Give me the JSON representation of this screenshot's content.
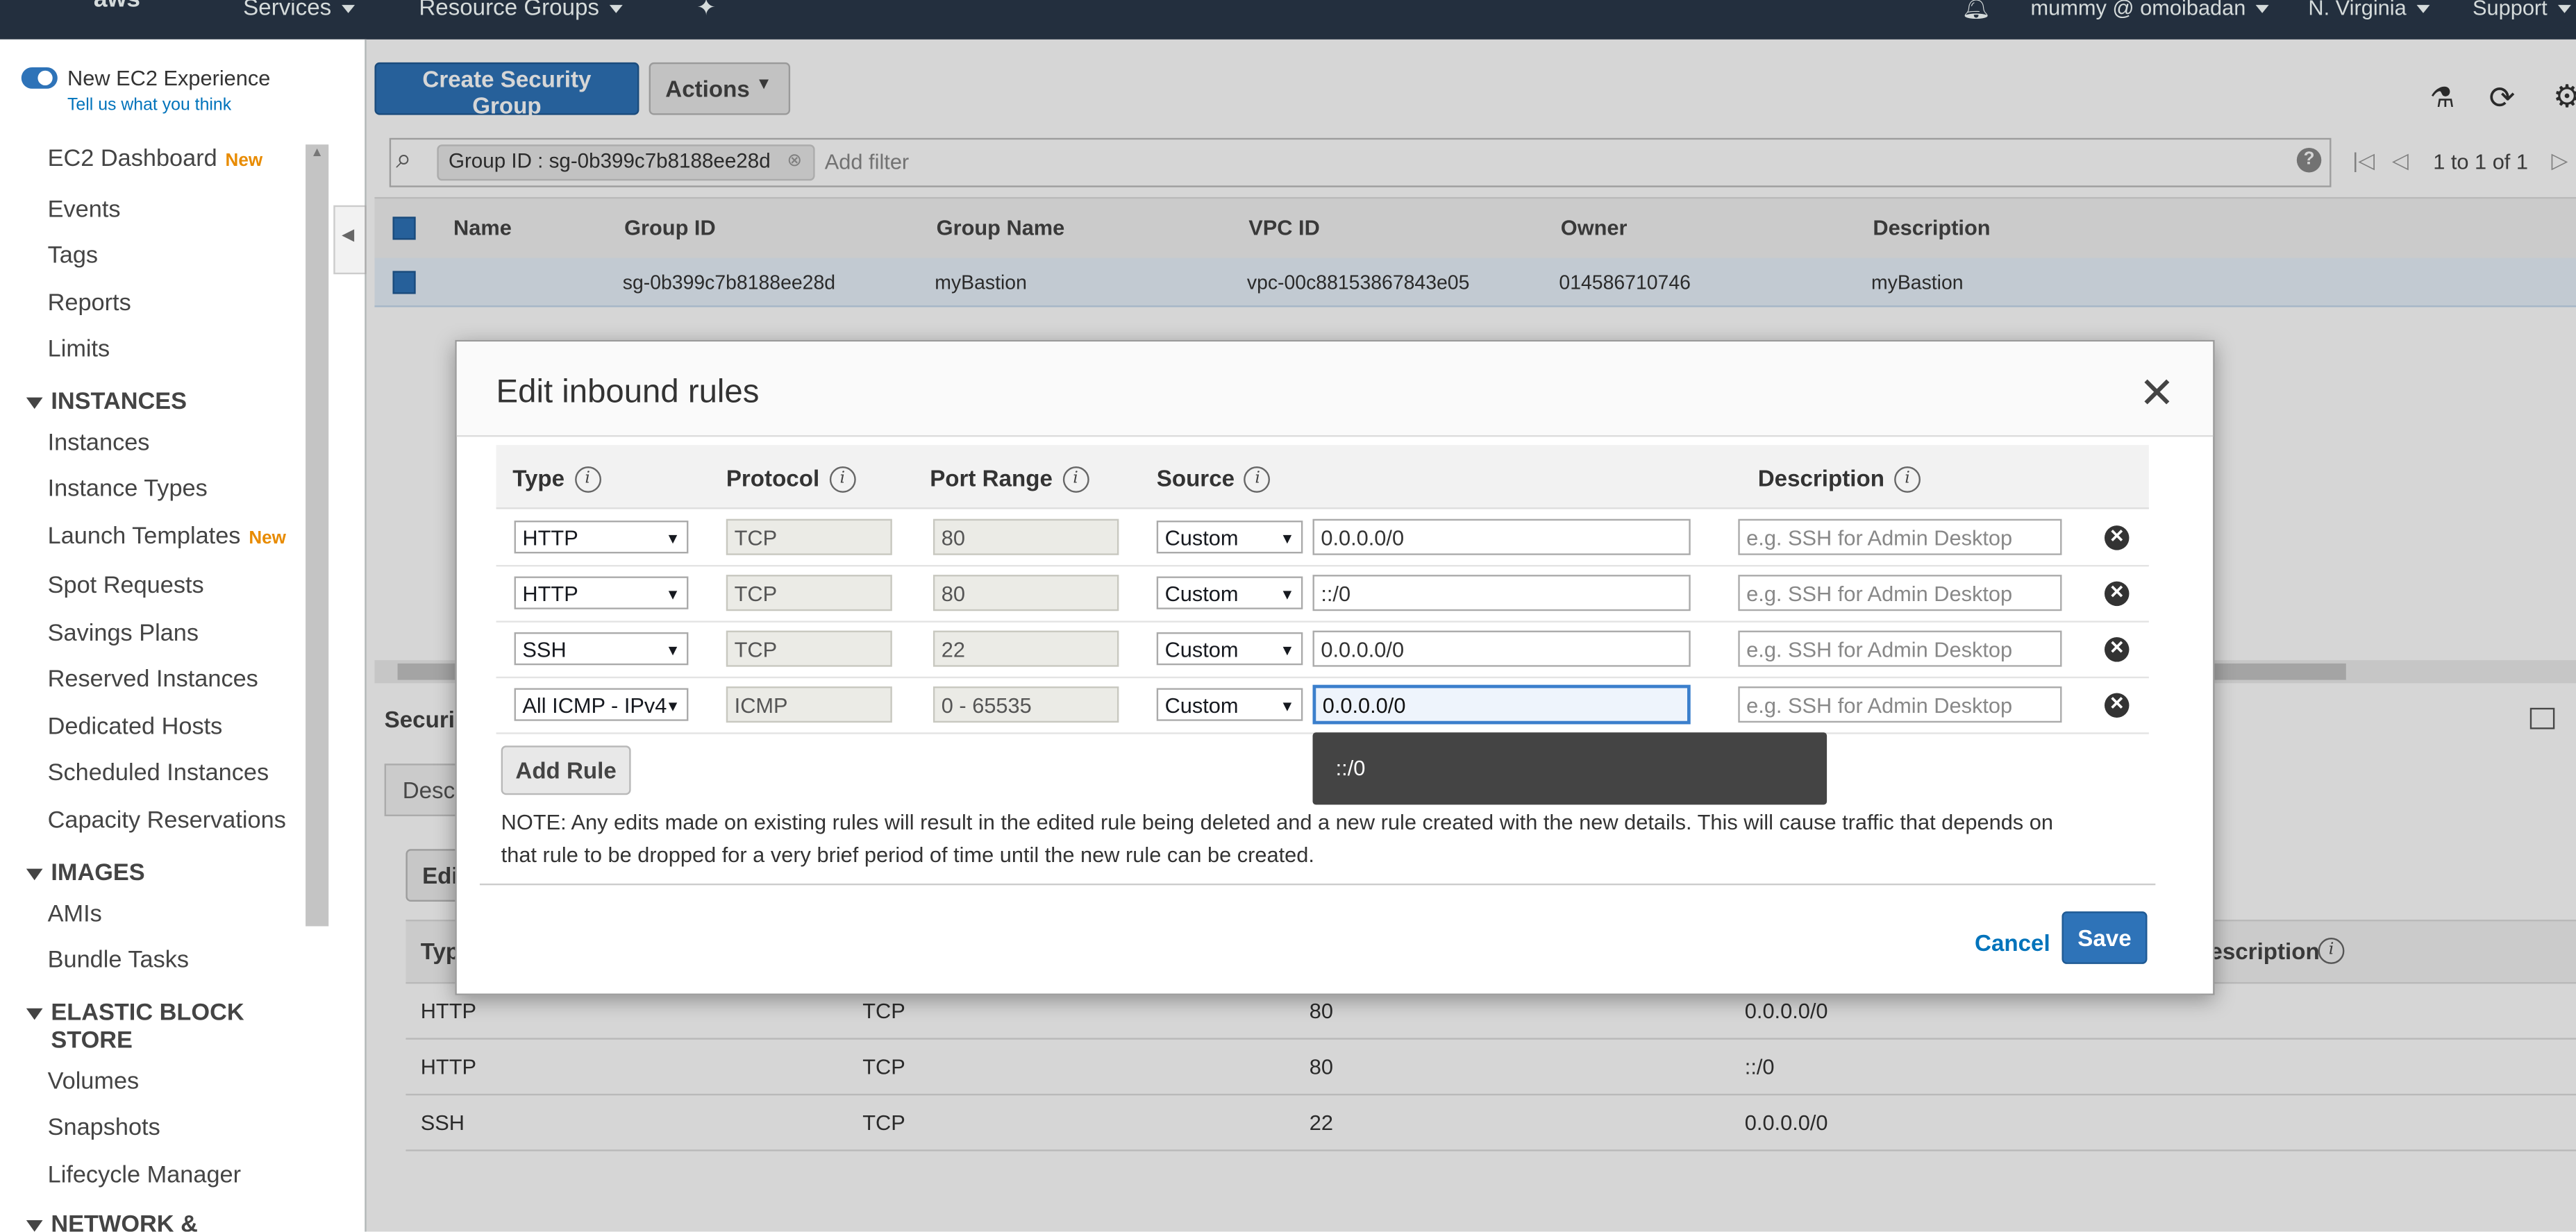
{
  "nav": {
    "logo": "aws",
    "services": "Services",
    "resource_groups": "Resource Groups",
    "account": "mummy @ omoibadan",
    "region": "N. Virginia",
    "support": "Support"
  },
  "sidebar": {
    "toggle_label": "New EC2 Experience",
    "toggle_link": "Tell us what you think",
    "dashboard": "EC2 Dashboard",
    "new_badge": "New",
    "items_top": [
      "Events",
      "Tags",
      "Reports",
      "Limits"
    ],
    "instances_header": "INSTANCES",
    "instances": [
      "Instances",
      "Instance Types",
      "Launch Templates",
      "Spot Requests",
      "Savings Plans",
      "Reserved Instances",
      "Dedicated Hosts",
      "Scheduled Instances",
      "Capacity Reservations"
    ],
    "images_header": "IMAGES",
    "images": [
      "AMIs",
      "Bundle Tasks"
    ],
    "ebs_header_1": "ELASTIC BLOCK",
    "ebs_header_2": "STORE",
    "ebs": [
      "Volumes",
      "Snapshots",
      "Lifecycle Manager"
    ],
    "network_header": "NETWORK &"
  },
  "toolbar": {
    "create": "Create Security Group",
    "actions": "Actions",
    "filter_chip": "Group ID : sg-0b399c7b8188ee28d",
    "add_filter": "Add filter",
    "pagination": "1 to 1 of 1"
  },
  "table": {
    "headers": [
      "Name",
      "Group ID",
      "Group Name",
      "VPC ID",
      "Owner",
      "Description"
    ],
    "row": {
      "name": "",
      "group_id": "sg-0b399c7b8188ee28d",
      "group_name": "myBastion",
      "vpc_id": "vpc-00c88153867843e05",
      "owner": "014586710746",
      "description": "myBastion"
    }
  },
  "lower": {
    "tab_frag": "Securi",
    "desc_frag": "Desc",
    "edit_frag": "Edi",
    "type_frag": "Typ",
    "desc_header_frag": "escription",
    "rows": [
      {
        "type": "HTTP",
        "protocol": "TCP",
        "port": "80",
        "source": "0.0.0.0/0"
      },
      {
        "type": "HTTP",
        "protocol": "TCP",
        "port": "80",
        "source": "::/0"
      },
      {
        "type": "SSH",
        "protocol": "TCP",
        "port": "22",
        "source": "0.0.0.0/0"
      }
    ]
  },
  "modal": {
    "title": "Edit inbound rules",
    "close": "✕",
    "headers": {
      "type": "Type",
      "protocol": "Protocol",
      "port_range": "Port Range",
      "source": "Source",
      "description": "Description"
    },
    "rules": [
      {
        "type": "HTTP",
        "protocol": "TCP",
        "port": "80",
        "source_type": "Custom",
        "source": "0.0.0.0/0"
      },
      {
        "type": "HTTP",
        "protocol": "TCP",
        "port": "80",
        "source_type": "Custom",
        "source": "::/0"
      },
      {
        "type": "SSH",
        "protocol": "TCP",
        "port": "22",
        "source_type": "Custom",
        "source": "0.0.0.0/0"
      },
      {
        "type": "All ICMP - IPv4",
        "protocol": "ICMP",
        "port": "0 - 65535",
        "source_type": "Custom",
        "source": "0.0.0.0/0"
      }
    ],
    "description_placeholder": "e.g. SSH for Admin Desktop",
    "autocomplete": "::/0",
    "add_rule": "Add Rule",
    "note": "NOTE: Any edits made on existing rules will result in the edited rule being deleted and a new rule created with the new details. This will cause traffic that depends on that rule to be dropped for a very brief period of time until the new rule can be created.",
    "cancel": "Cancel",
    "save": "Save"
  },
  "colors": {
    "nav_bg": "#232f3e",
    "primary": "#2e73b8",
    "new_badge": "#e88b00",
    "link": "#0073bb"
  }
}
